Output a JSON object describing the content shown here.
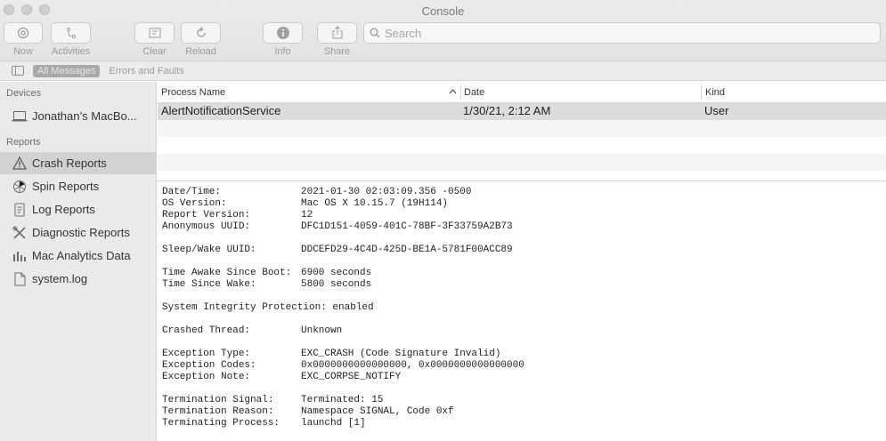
{
  "window": {
    "title": "Console"
  },
  "toolbar": {
    "now": "Now",
    "activities": "Activities",
    "clear": "Clear",
    "reload": "Reload",
    "info": "Info",
    "share": "Share",
    "search_placeholder": "Search"
  },
  "filter": {
    "all_messages": "All Messages",
    "errors_and_faults": "Errors and Faults"
  },
  "sidebar": {
    "devices_header": "Devices",
    "device_name": "Jonathan’s MacBo...",
    "reports_header": "Reports",
    "items": [
      {
        "label": "Crash Reports",
        "icon": "warning-icon"
      },
      {
        "label": "Spin Reports",
        "icon": "spin-icon"
      },
      {
        "label": "Log Reports",
        "icon": "log-icon"
      },
      {
        "label": "Diagnostic Reports",
        "icon": "tools-icon"
      },
      {
        "label": "Mac Analytics Data",
        "icon": "bar-chart-icon"
      },
      {
        "label": "system.log",
        "icon": "document-icon"
      }
    ]
  },
  "table": {
    "columns": {
      "process": "Process Name",
      "date": "Date",
      "kind": "Kind"
    },
    "rows": [
      {
        "process": "AlertNotificationService",
        "date": "1/30/21, 2:12 AM",
        "kind": "User"
      }
    ]
  },
  "details": {
    "datetime_k": "Date/Time:",
    "datetime_v": "2021-01-30 02:03:09.356 -0500",
    "os_k": "OS Version:",
    "os_v": "Mac OS X 10.15.7 (19H114)",
    "rv_k": "Report Version:",
    "rv_v": "12",
    "anon_k": "Anonymous UUID:",
    "anon_v": "DFC1D151-4059-401C-78BF-3F33759A2B73",
    "sleep_k": "Sleep/Wake UUID:",
    "sleep_v": "DDCEFD29-4C4D-425D-BE1A-5781F00ACC89",
    "awake_k": "Time Awake Since Boot:",
    "awake_v": "6900 seconds",
    "wake_k": "Time Since Wake:",
    "wake_v": "5800 seconds",
    "sip": "System Integrity Protection: enabled",
    "crashed_k": "Crashed Thread:",
    "crashed_v": "Unknown",
    "etype_k": "Exception Type:",
    "etype_v": "EXC_CRASH (Code Signature Invalid)",
    "ecodes_k": "Exception Codes:",
    "ecodes_v": "0x0000000000000000, 0x0000000000000000",
    "enote_k": "Exception Note:",
    "enote_v": "EXC_CORPSE_NOTIFY",
    "tsig_k": "Termination Signal:",
    "tsig_v": "Terminated: 15",
    "treason_k": "Termination Reason:",
    "treason_v": "Namespace SIGNAL, Code 0xf",
    "tproc_k": "Terminating Process:",
    "tproc_v": "launchd [1]"
  }
}
